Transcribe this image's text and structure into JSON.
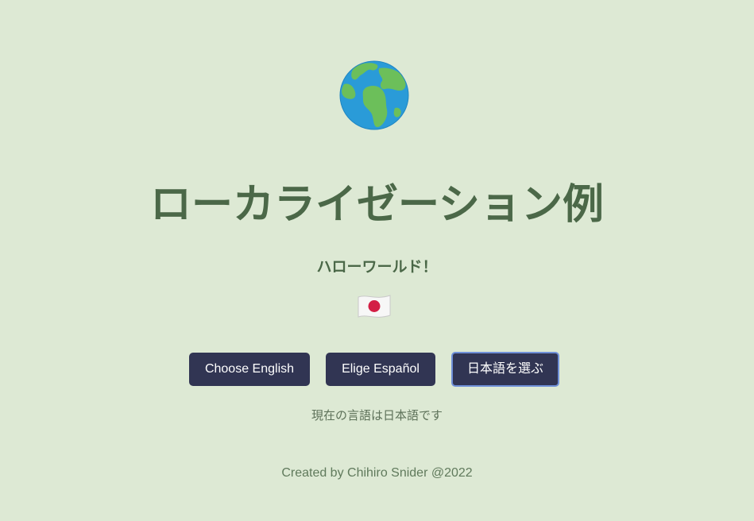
{
  "header": {
    "globe_icon": "earth-globe-africa-europe-icon",
    "title": "ローカライゼーション例"
  },
  "main": {
    "greeting": "ハローワールド！",
    "flag_icon": "japan-flag-icon",
    "buttons": [
      {
        "label": "Choose English",
        "active": false
      },
      {
        "label": "Elige Español",
        "active": false
      },
      {
        "label": "日本語を選ぶ",
        "active": true
      }
    ],
    "current_language_text": "現在の言語は日本語です"
  },
  "footer": {
    "credit": "Created by Chihiro Snider @2022"
  },
  "colors": {
    "background": "#dde9d4",
    "heading": "#4b6848",
    "button_bg": "#313553",
    "button_focus_ring": "#6f90d8",
    "ocean": "#2a9bd8",
    "land": "#6cbf5a",
    "flag_red": "#d31f45"
  }
}
